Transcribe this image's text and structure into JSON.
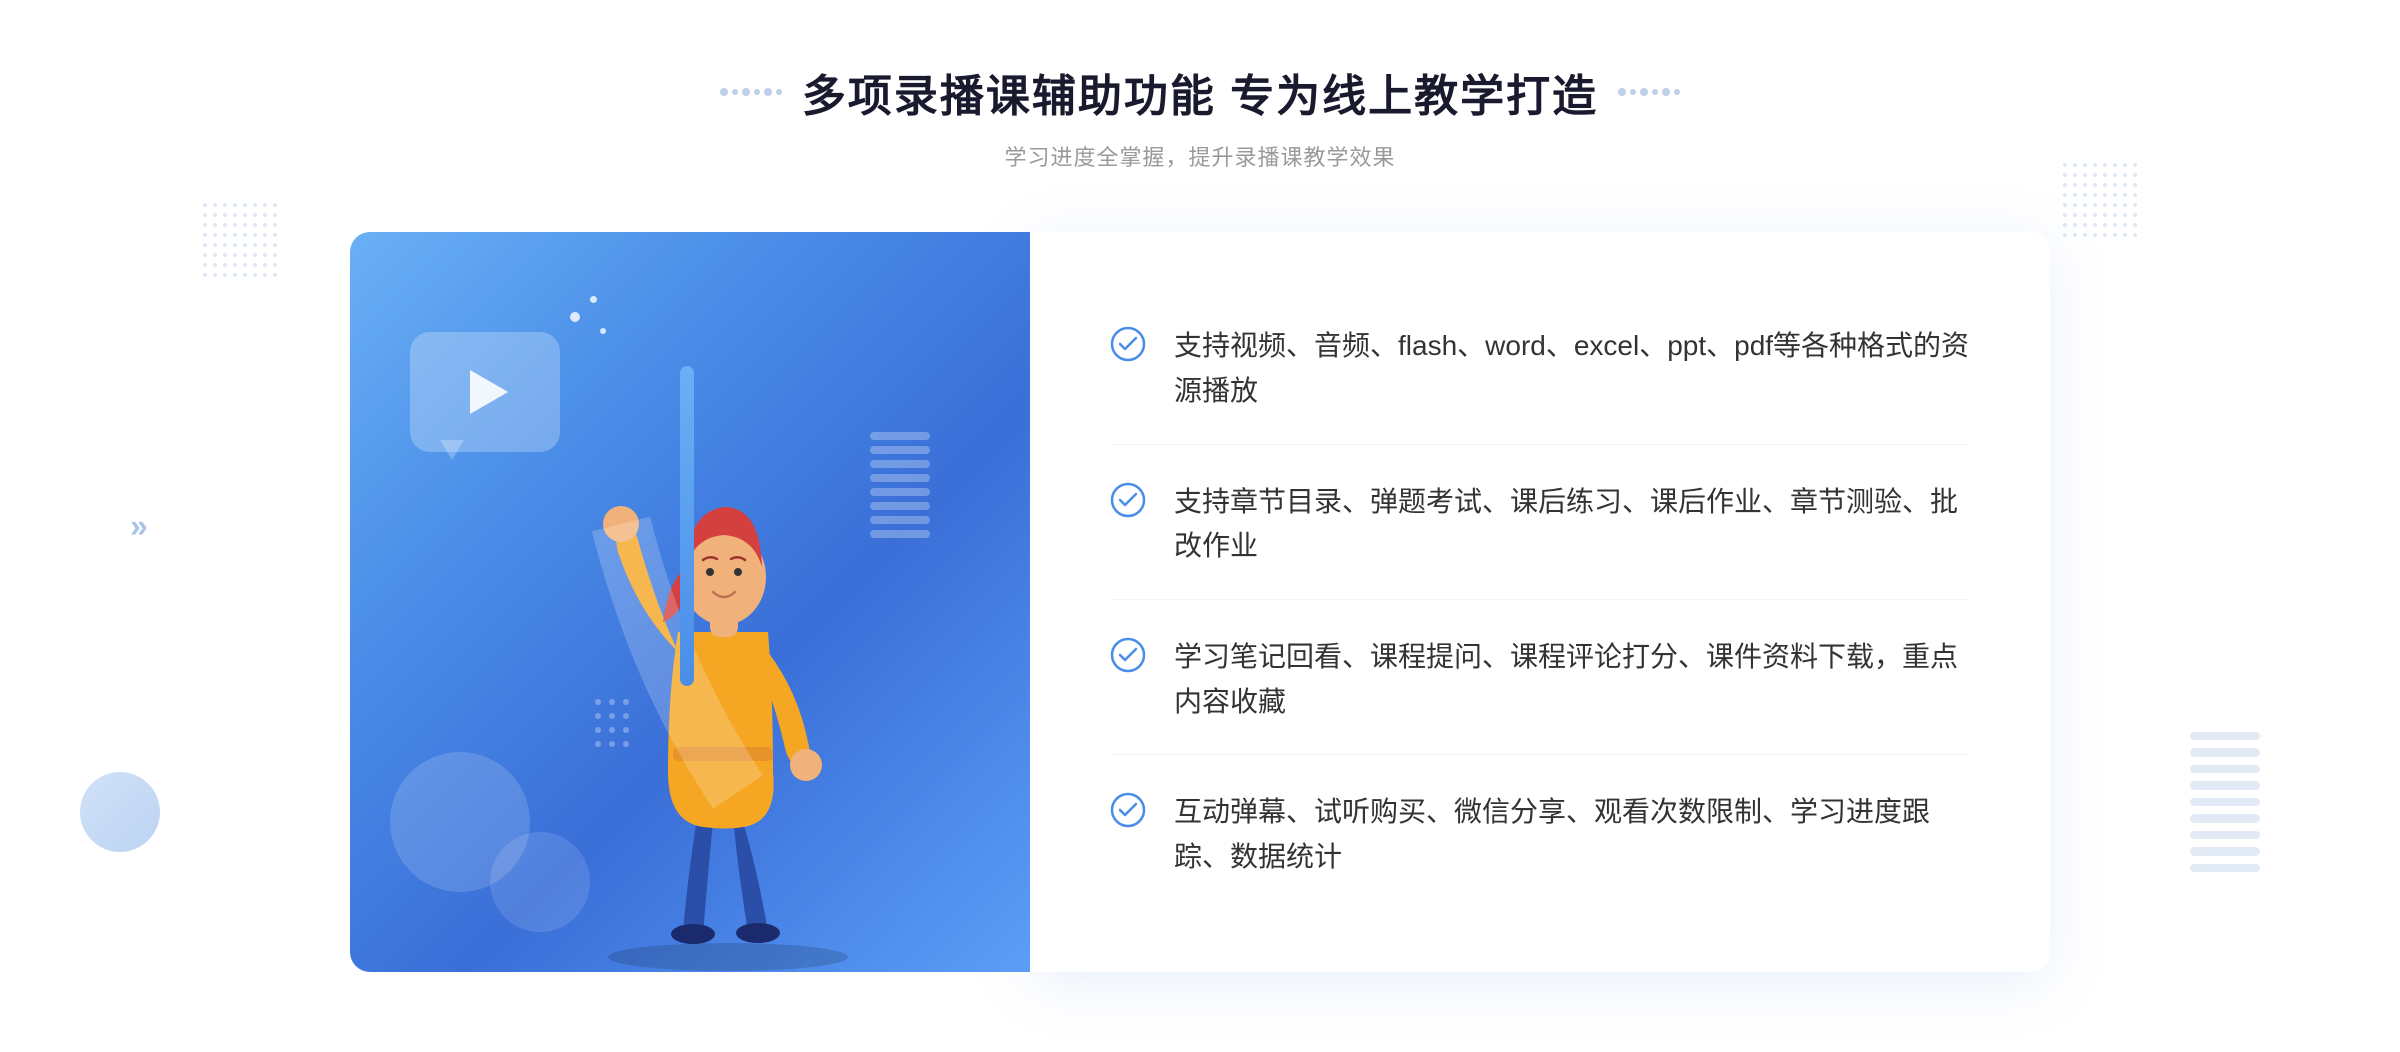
{
  "header": {
    "title": "多项录播课辅助功能 专为线上教学打造",
    "subtitle": "学习进度全掌握，提升录播课教学效果",
    "dots_deco_left": ":::::",
    "dots_deco_right": ":::::"
  },
  "features": [
    {
      "id": 1,
      "text": "支持视频、音频、flash、word、excel、ppt、pdf等各种格式的资源播放"
    },
    {
      "id": 2,
      "text": "支持章节目录、弹题考试、课后练习、课后作业、章节测验、批改作业"
    },
    {
      "id": 3,
      "text": "学习笔记回看、课程提问、课程评论打分、课件资料下载，重点内容收藏"
    },
    {
      "id": 4,
      "text": "互动弹幕、试听购买、微信分享、观看次数限制、学习进度跟踪、数据统计"
    }
  ],
  "colors": {
    "primary_blue": "#4a8de8",
    "light_blue": "#6ab0f5",
    "check_color": "#4a8de8",
    "title_color": "#1a1a2e",
    "text_color": "#333333",
    "subtitle_color": "#999999"
  }
}
